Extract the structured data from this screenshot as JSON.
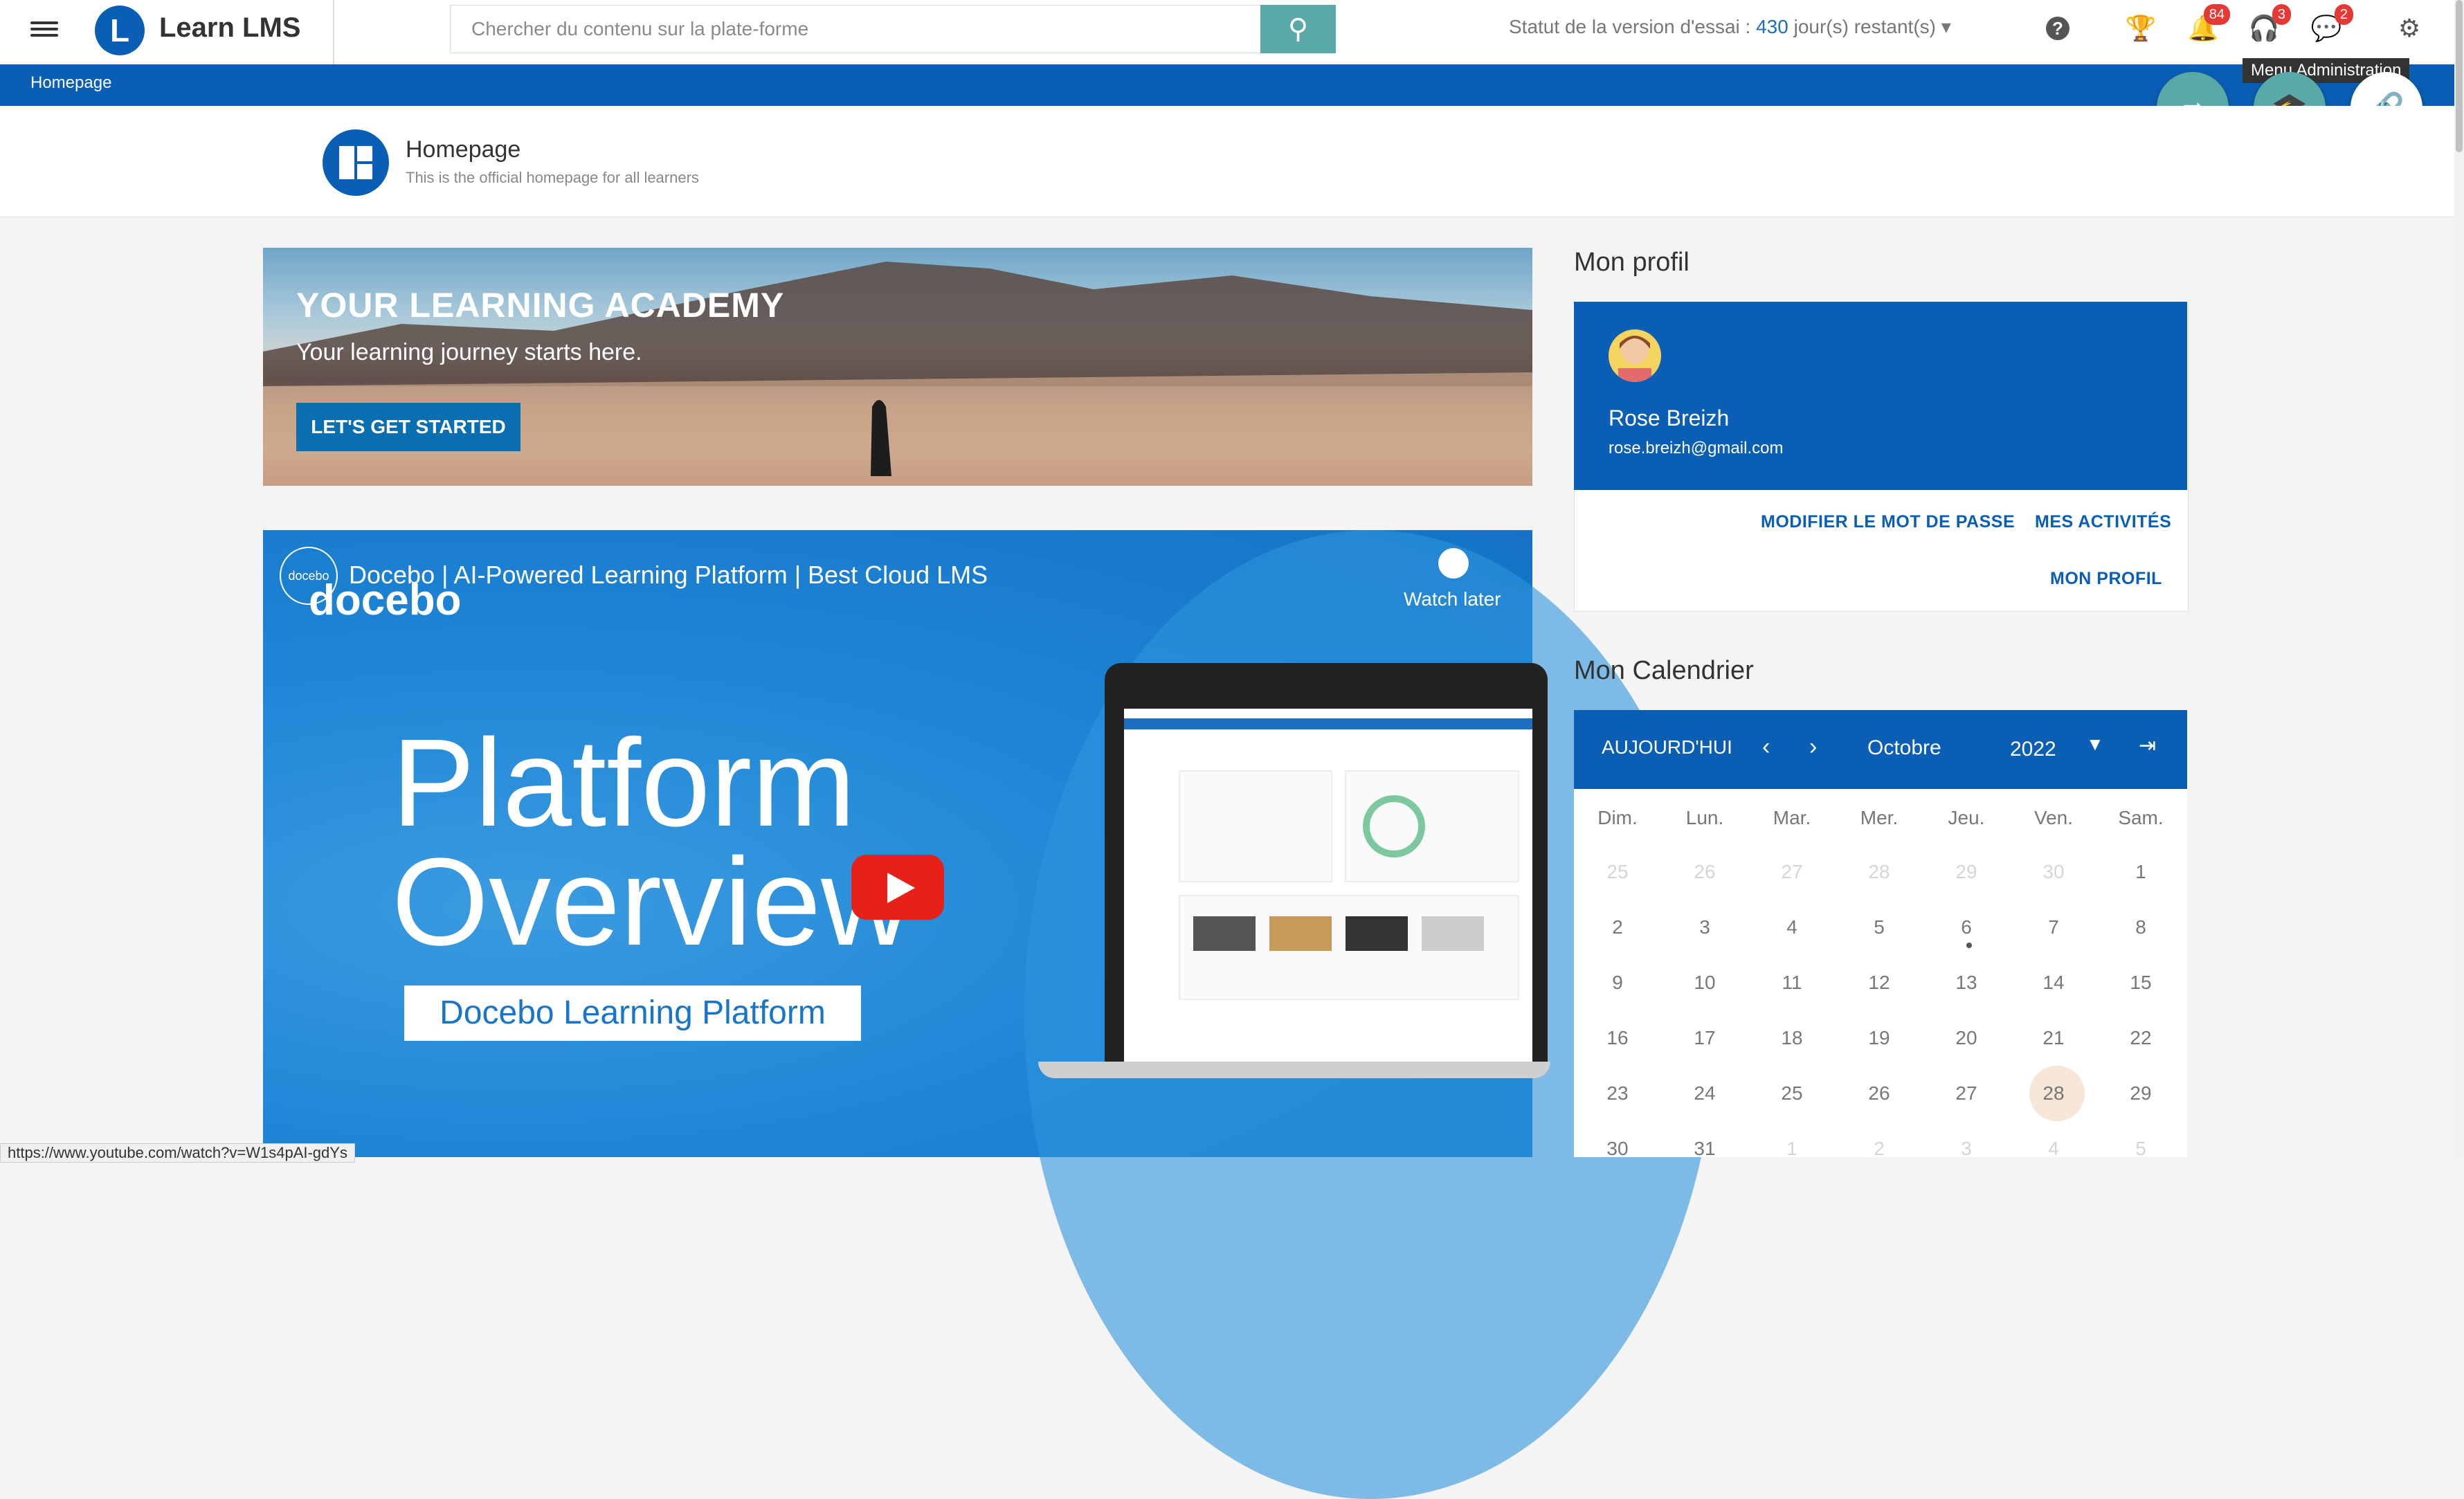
{
  "topbar": {
    "brand": "Learn LMS",
    "search_placeholder": "Chercher du contenu sur la plate-forme",
    "trial_prefix": "Statut de la version d'essai : ",
    "trial_days": "430",
    "trial_suffix": " jour(s) restant(s)",
    "badges": {
      "notifications": "84",
      "gamification": "3",
      "messages": "2"
    },
    "tooltip": "Menu Administration",
    "icons": [
      "hamburger-icon",
      "search-icon",
      "help-icon",
      "trophy-icon",
      "bell-icon",
      "headset-icon",
      "chat-icon",
      "gear-icon"
    ]
  },
  "breadcrumb": {
    "current": "Homepage"
  },
  "fabs": {
    "colors": {
      "share": "#5aa9a9",
      "learn": "#5aa9a9",
      "link": "#ffffff"
    }
  },
  "page": {
    "title": "Homepage",
    "subtitle": "This is the official homepage for all learners"
  },
  "banner": {
    "title": "YOUR LEARNING ACADEMY",
    "subtitle": "Your learning journey starts here.",
    "button": "LET'S GET STARTED"
  },
  "video": {
    "channel_badge": "docebo",
    "title": "Docebo | AI-Powered Learning Platform | Best Cloud LMS",
    "logo_word": "docebo",
    "watch_later": "Watch later",
    "big_line1": "Platform",
    "big_line2": "Overview",
    "subtitle_box": "Docebo Learning Platform"
  },
  "status_url": "https://www.youtube.com/watch?v=W1s4pAI-gdYs",
  "profile": {
    "heading": "Mon profil",
    "name": "Rose Breizh",
    "email": "rose.breizh@gmail.com",
    "link_password": "MODIFIER LE MOT DE PASSE",
    "link_activities": "MES ACTIVITÉS",
    "link_profile": "MON PROFIL"
  },
  "calendar": {
    "heading": "Mon Calendrier",
    "today_btn": "AUJOURD'HUI",
    "month": "Octobre",
    "year": "2022",
    "weekdays": [
      "Dim.",
      "Lun.",
      "Mar.",
      "Mer.",
      "Jeu.",
      "Ven.",
      "Sam."
    ],
    "weeks": [
      [
        "25",
        "26",
        "27",
        "28",
        "29",
        "30",
        "1"
      ],
      [
        "2",
        "3",
        "4",
        "5",
        "6",
        "7",
        "8"
      ],
      [
        "9",
        "10",
        "11",
        "12",
        "13",
        "14",
        "15"
      ],
      [
        "16",
        "17",
        "18",
        "19",
        "20",
        "21",
        "22"
      ],
      [
        "23",
        "24",
        "25",
        "26",
        "27",
        "28",
        "29"
      ],
      [
        "30",
        "31",
        "1",
        "2",
        "3",
        "4",
        "5"
      ]
    ]
  },
  "accent": "#0a5fb4"
}
